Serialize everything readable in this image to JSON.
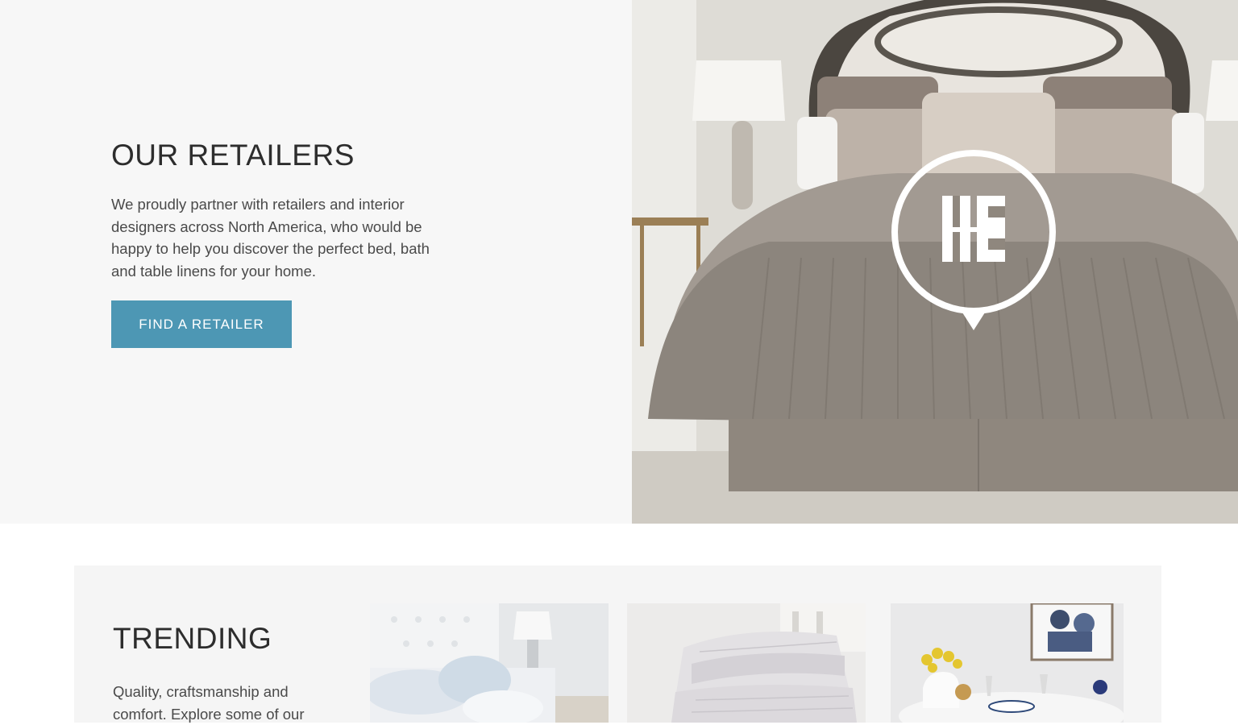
{
  "retailers": {
    "title": "OUR RETAILERS",
    "description": "We proudly partner with retailers and interior designers across North America, who would be happy to help you discover the perfect bed, bath and table linens for your home.",
    "button_label": "FIND A RETAILER",
    "image_icon": "retailer-location-pin-icon"
  },
  "trending": {
    "title": "TRENDING",
    "description": "Quality, craftsmanship and comfort. Explore some of our",
    "cards": [
      {
        "icon": "bedroom-pillows-image"
      },
      {
        "icon": "folded-quilt-image"
      },
      {
        "icon": "table-setting-image"
      }
    ]
  },
  "colors": {
    "accent": "#4d97b4",
    "section_background": "#f7f7f7",
    "heading": "#2d2d2d",
    "body_text": "#4a4a4a"
  }
}
